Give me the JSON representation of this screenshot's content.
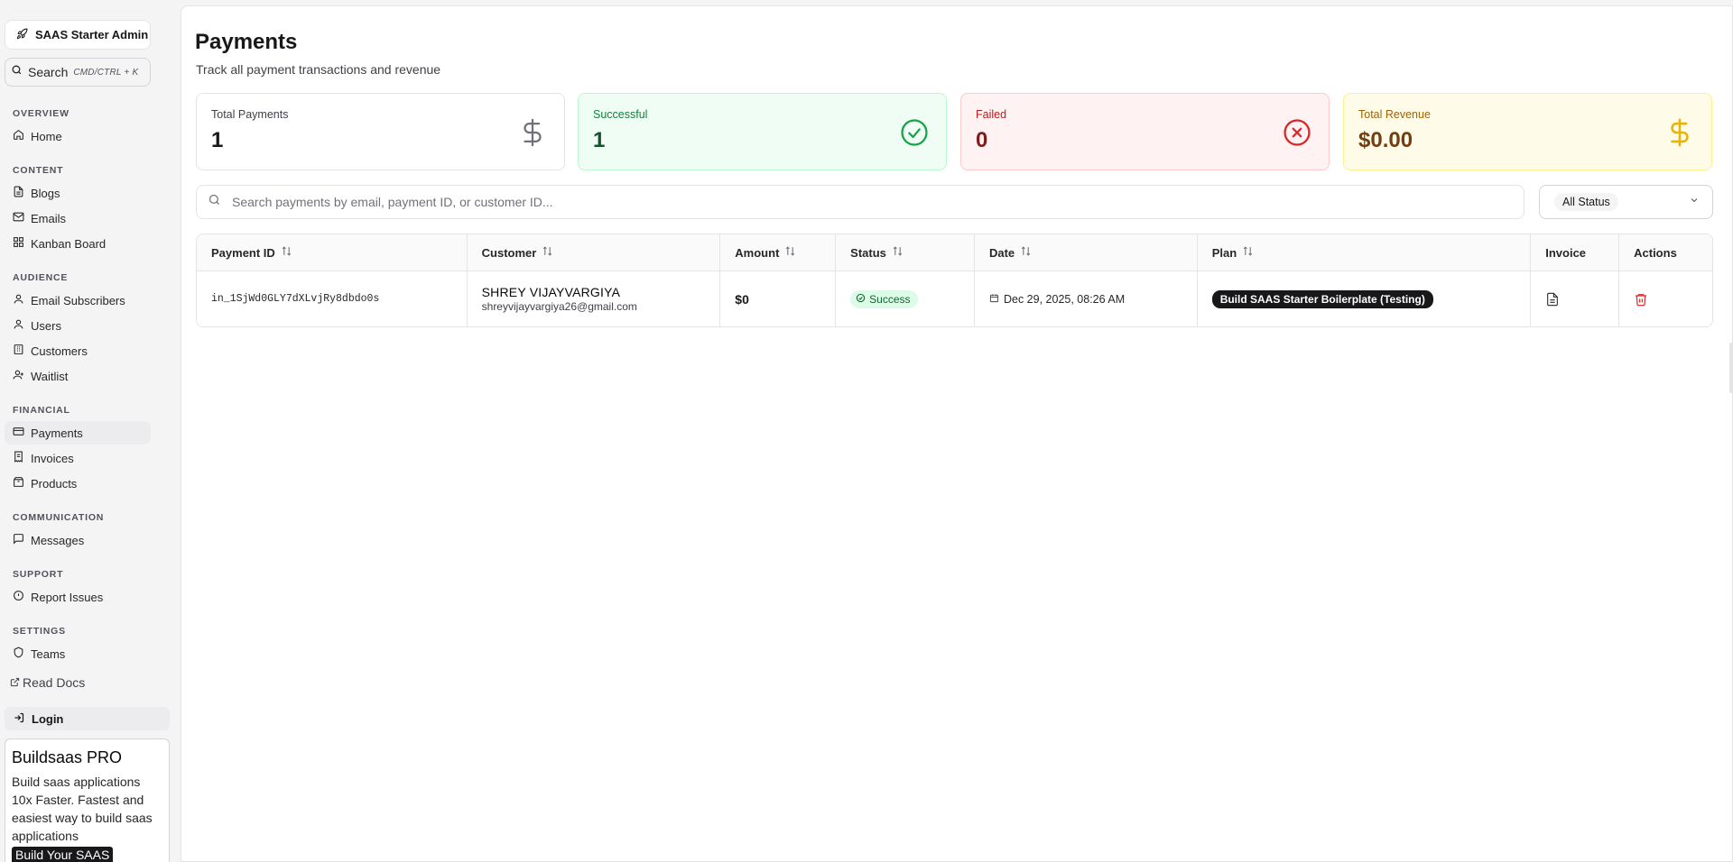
{
  "sidebar": {
    "brand": "SAAS Starter Admin",
    "search_label": "Search",
    "search_hint": "CMD/CTRL + K",
    "sections": {
      "overview": "OVERVIEW",
      "content": "CONTENT",
      "audience": "AUDIENCE",
      "financial": "FINANCIAL",
      "communication": "COMMUNICATION",
      "support": "SUPPORT",
      "settings": "SETTINGS"
    },
    "items": {
      "home": "Home",
      "blogs": "Blogs",
      "emails": "Emails",
      "kanban": "Kanban Board",
      "subscribers": "Email Subscribers",
      "users": "Users",
      "customers": "Customers",
      "waitlist": "Waitlist",
      "payments": "Payments",
      "invoices": "Invoices",
      "products": "Products",
      "messages": "Messages",
      "report": "Report Issues",
      "teams": "Teams"
    },
    "read_docs": "Read Docs",
    "login": "Login",
    "promo": {
      "title": "Buildsaas PRO",
      "text": "Build saas applications 10x Faster. Fastest and easiest way to build saas applications",
      "button": "Build Your SAAS"
    }
  },
  "page": {
    "title": "Payments",
    "subtitle": "Track all payment transactions and revenue"
  },
  "stats": {
    "total": {
      "label": "Total Payments",
      "value": "1"
    },
    "successful": {
      "label": "Successful",
      "value": "1"
    },
    "failed": {
      "label": "Failed",
      "value": "0"
    },
    "revenue": {
      "label": "Total Revenue",
      "value": "$0.00"
    }
  },
  "filters": {
    "search_placeholder": "Search payments by email, payment ID, or customer ID...",
    "status_selected": "All Status"
  },
  "table": {
    "headers": {
      "payment_id": "Payment ID",
      "customer": "Customer",
      "amount": "Amount",
      "status": "Status",
      "date": "Date",
      "plan": "Plan",
      "invoice": "Invoice",
      "actions": "Actions"
    },
    "rows": [
      {
        "payment_id": "in_1SjWd0GLY7dXLvjRy8dbdo0s",
        "customer_name": "SHREY VIJAYVARGIYA",
        "customer_email": "shreyvijayvargiya26@gmail.com",
        "amount": "$0",
        "status": "Success",
        "date": "Dec 29, 2025, 08:26 AM",
        "plan": "Build SAAS Starter Boilerplate (Testing)"
      }
    ]
  },
  "colors": {
    "success": "#16a34a",
    "failed": "#dc2626",
    "revenue": "#eab308",
    "delete": "#dc2626"
  },
  "icons": [
    "rocket-icon",
    "search-icon",
    "home-icon",
    "file-icon",
    "mail-icon",
    "kanban-icon",
    "user-icon",
    "users-icon",
    "building-icon",
    "clock-icon",
    "credit-card-icon",
    "receipt-icon",
    "package-icon",
    "message-icon",
    "alert-circle-icon",
    "shield-icon",
    "external-link-icon",
    "login-icon",
    "dollar-icon",
    "check-circle-icon",
    "x-circle-icon",
    "chevron-down-icon",
    "sort-icon",
    "calendar-icon",
    "document-icon",
    "trash-icon"
  ]
}
